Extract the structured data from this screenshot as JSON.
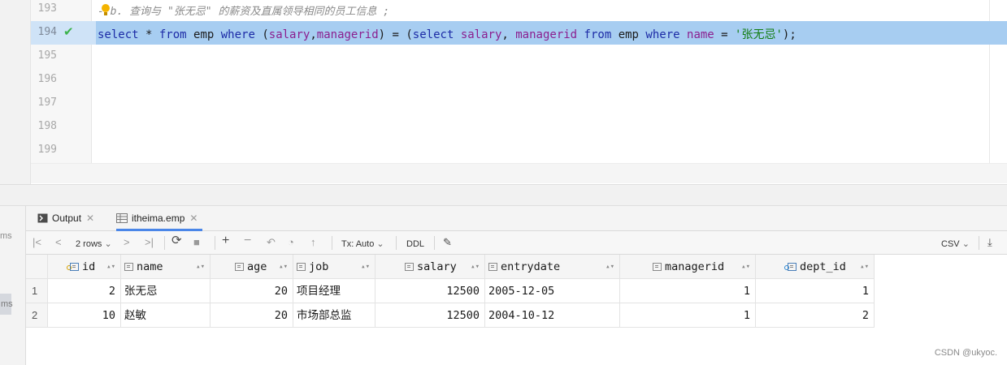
{
  "left_strip": {
    "frag_top": "ms",
    "frag_selected": "ms"
  },
  "editor": {
    "lines": [
      {
        "num": "193",
        "comment": "- b. 查询与 \"张无忌\" 的薪资及直属领导相同的员工信息 ;"
      },
      {
        "num": "194",
        "status": "executed-check-icon"
      },
      {
        "num": "195"
      },
      {
        "num": "196"
      },
      {
        "num": "197"
      },
      {
        "num": "198"
      },
      {
        "num": "199"
      }
    ],
    "sql": {
      "t1": "select",
      "t2": " * ",
      "t3": "from",
      "t4": " emp ",
      "t5": "where",
      "t6": " (",
      "t7": "salary",
      "t8": ",",
      "t9": "managerid",
      "t10": ") = (",
      "t11": "select",
      "t12": " ",
      "t13": "salary",
      "t14": ", ",
      "t15": "managerid",
      "t16": " ",
      "t17": "from",
      "t18": " emp ",
      "t19": "where",
      "t20": " ",
      "t21": "name",
      "t22": " = ",
      "t23": "'张无忌'",
      "t24": ");"
    },
    "colors": {
      "keyword": "#1c2ba6",
      "identifier": "#8b1f8f",
      "string": "#107c10",
      "highlight": "#a7cdf1"
    }
  },
  "tabs": [
    {
      "label": "Output",
      "icon": "console-icon",
      "closable": true
    },
    {
      "label": "itheima.emp",
      "icon": "table-icon",
      "closable": true,
      "active": true
    }
  ],
  "toolbar": {
    "rows_label": "2 rows",
    "tx_label": "Tx: Auto",
    "ddl_label": "DDL",
    "export_label": "CSV"
  },
  "grid": {
    "columns": [
      {
        "name": "id",
        "kind": "pk"
      },
      {
        "name": "name",
        "kind": "col"
      },
      {
        "name": "age",
        "kind": "col"
      },
      {
        "name": "job",
        "kind": "col"
      },
      {
        "name": "salary",
        "kind": "col"
      },
      {
        "name": "entrydate",
        "kind": "col"
      },
      {
        "name": "managerid",
        "kind": "col"
      },
      {
        "name": "dept_id",
        "kind": "fk"
      }
    ],
    "rows": [
      {
        "rownum": "1",
        "id": "2",
        "name": "张无忌",
        "age": "20",
        "job": "项目经理",
        "salary": "12500",
        "entrydate": "2005-12-05",
        "managerid": "1",
        "dept_id": "1"
      },
      {
        "rownum": "2",
        "id": "10",
        "name": "赵敏",
        "age": "20",
        "job": "市场部总监",
        "salary": "12500",
        "entrydate": "2004-10-12",
        "managerid": "1",
        "dept_id": "2"
      }
    ]
  },
  "watermark": "CSDN @ukyoc."
}
